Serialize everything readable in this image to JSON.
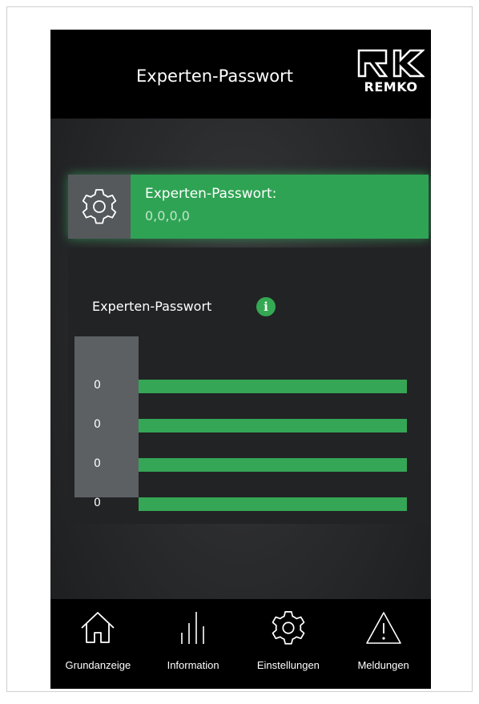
{
  "header": {
    "title": "Experten-Passwort",
    "logo_text": "REMKO"
  },
  "setting": {
    "label": "Experten-Passwort:",
    "value": "0,0,0,0",
    "icon": "gear-icon",
    "accent_color": "#2fa354"
  },
  "editor": {
    "title": "Experten-Passwort",
    "info_icon": "info-icon",
    "digits": [
      "0",
      "0",
      "0",
      "0"
    ]
  },
  "nav": {
    "items": [
      {
        "label": "Grundanzeige",
        "icon": "home-icon"
      },
      {
        "label": "Information",
        "icon": "bars-icon"
      },
      {
        "label": "Einstellungen",
        "icon": "gear-icon"
      },
      {
        "label": "Meldungen",
        "icon": "warning-icon"
      }
    ]
  },
  "colors": {
    "background": "#000000",
    "accent": "#34a853",
    "panel": "#222325"
  }
}
